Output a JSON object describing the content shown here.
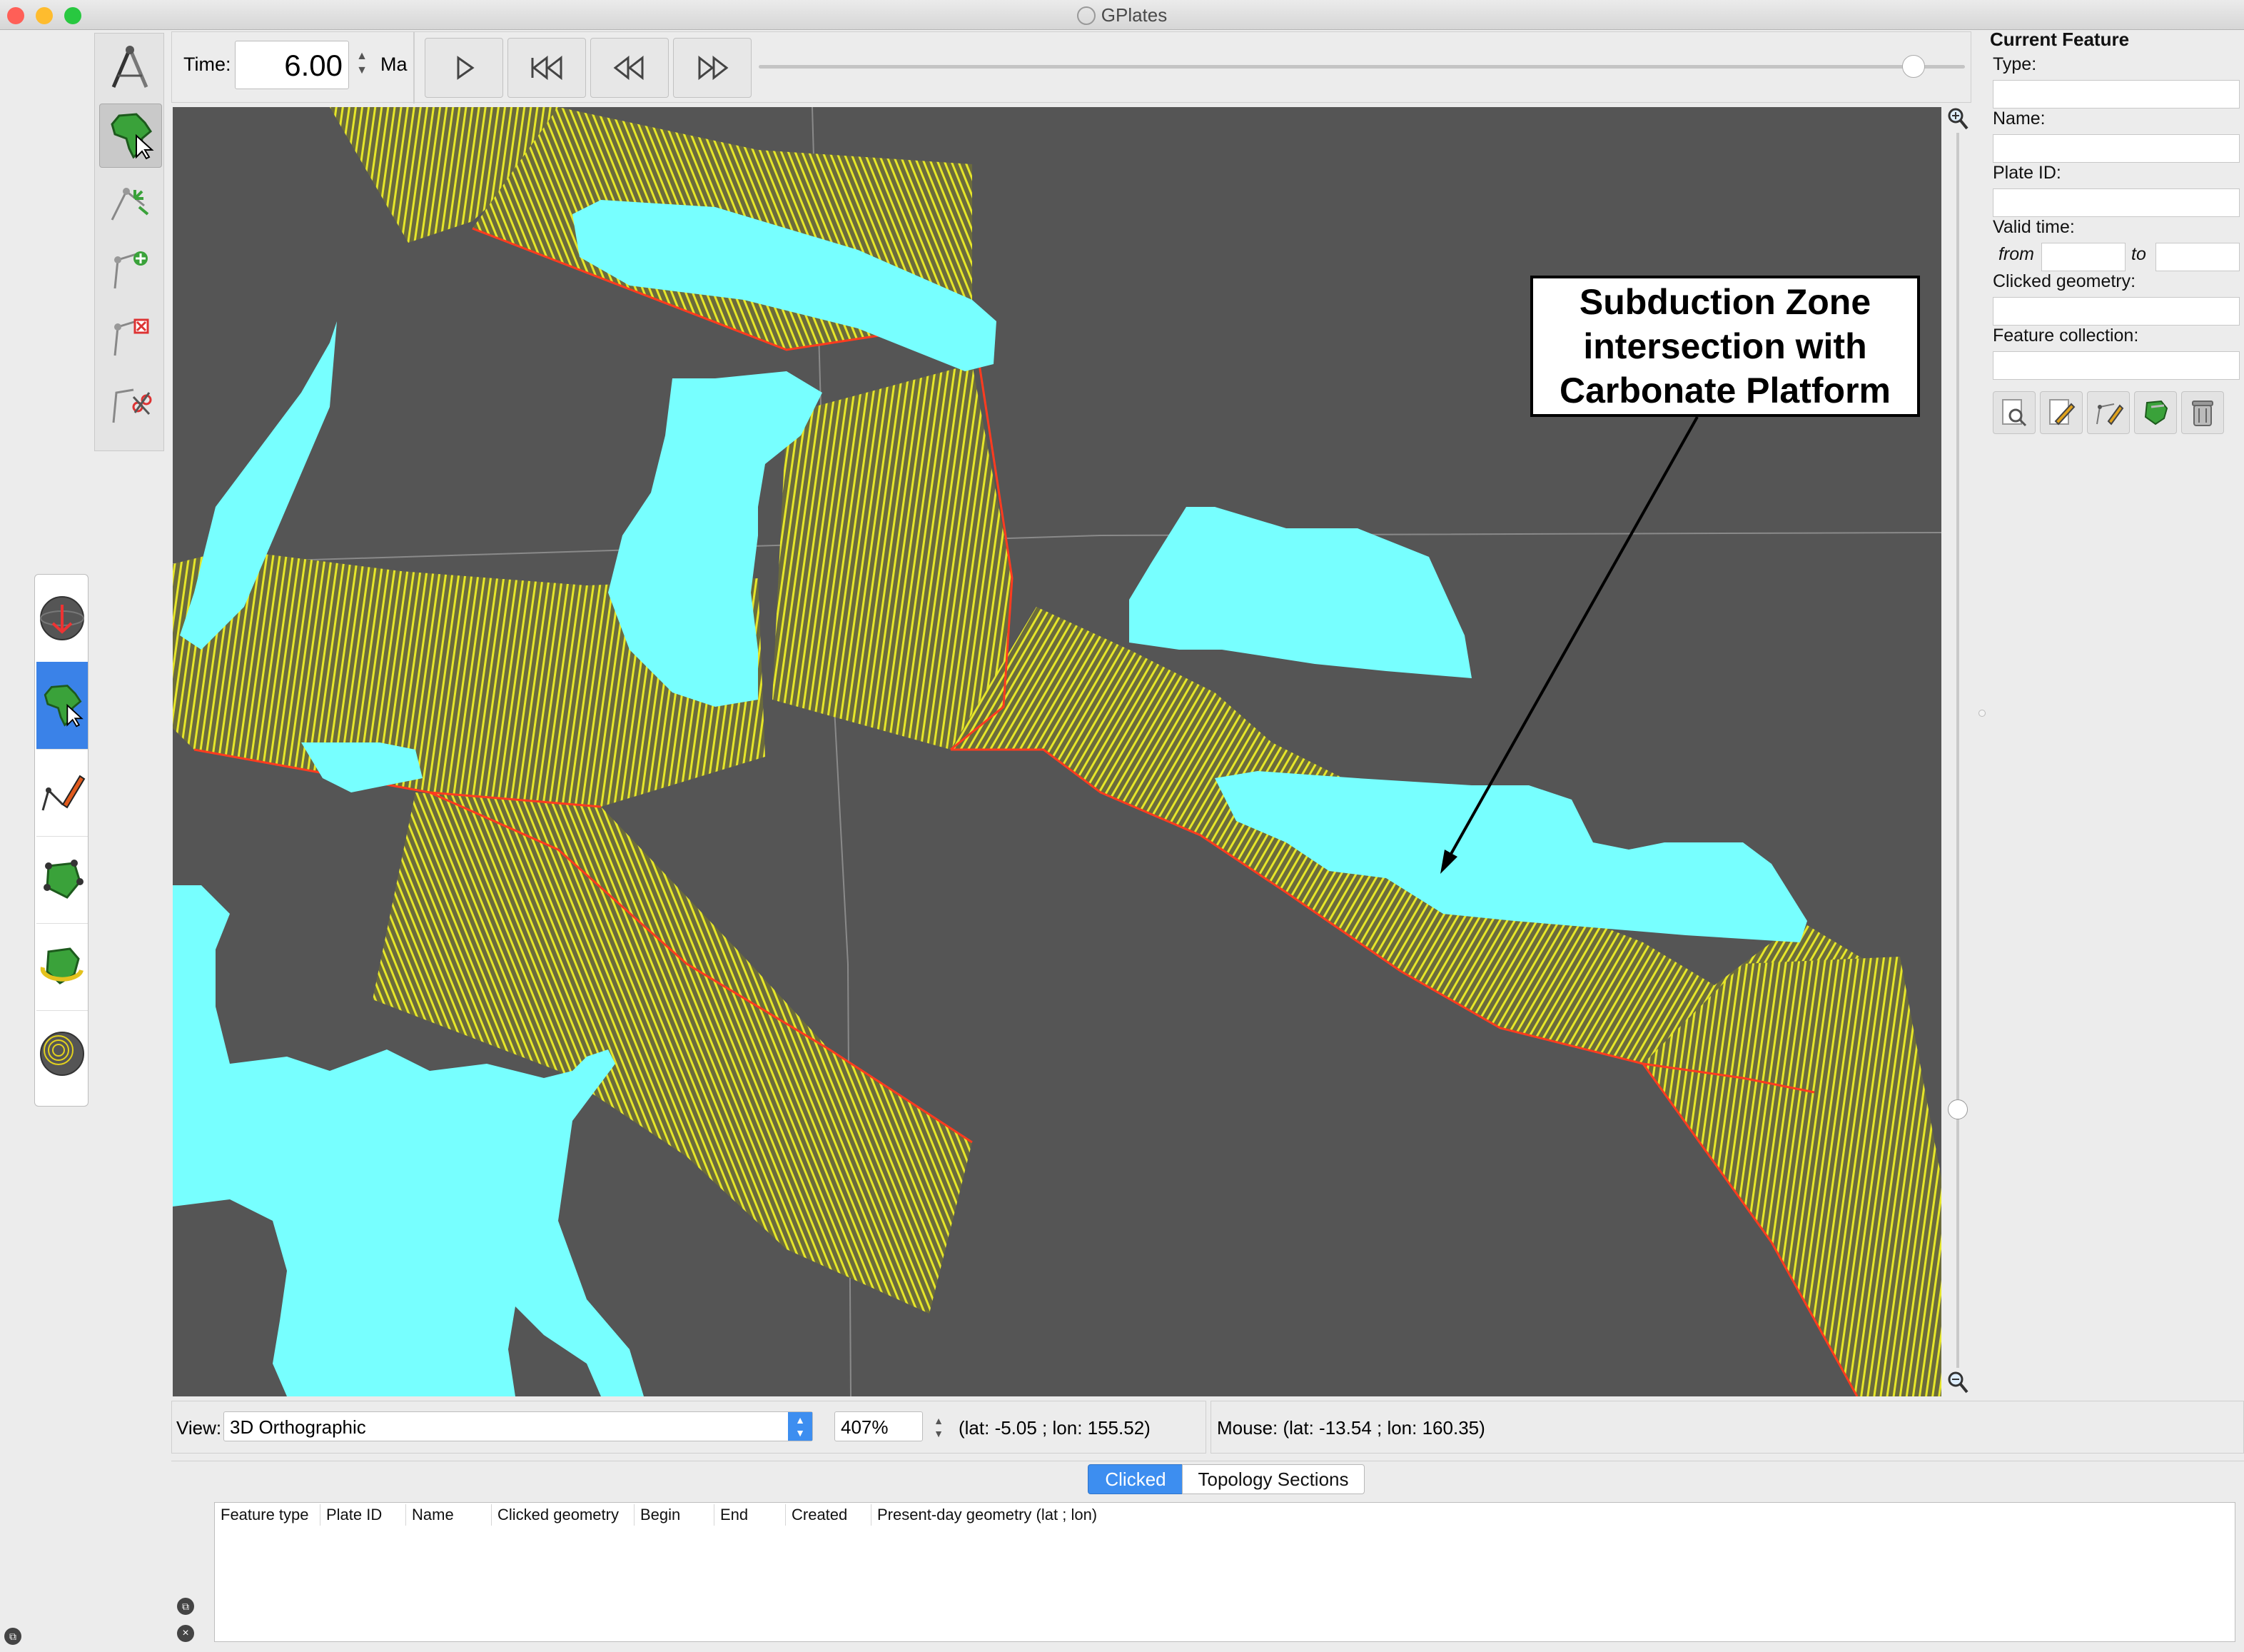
{
  "window": {
    "title": "GPlates"
  },
  "time_controls": {
    "label": "Time:",
    "value": "6.00",
    "unit": "Ma"
  },
  "annotation": {
    "lines": [
      "Subduction Zone",
      "intersection with",
      "Carbonate Platform"
    ]
  },
  "current_feature": {
    "heading": "Current Feature",
    "type_label": "Type:",
    "name_label": "Name:",
    "plate_id_label": "Plate ID:",
    "valid_time_label": "Valid time:",
    "from_label": "from",
    "to_label": "to",
    "clicked_geometry_label": "Clicked geometry:",
    "feature_collection_label": "Feature collection:"
  },
  "view_bar": {
    "label": "View:",
    "projection": "3D Orthographic",
    "zoom": "407%",
    "camera_coords": "(lat: -5.05 ; lon: 155.52)"
  },
  "mouse_bar": {
    "text": "Mouse: (lat: -13.54 ; lon: 160.35)"
  },
  "bottom_panel": {
    "tabs": [
      {
        "label": "Clicked",
        "active": true
      },
      {
        "label": "Topology Sections",
        "active": false
      }
    ],
    "columns": [
      "Feature type",
      "Plate ID",
      "Name",
      "Clicked geometry",
      "Begin",
      "End",
      "Created",
      "Present-day geometry (lat ; lon)"
    ]
  },
  "colors": {
    "globe_background": "#555555",
    "platform": "#77ffff",
    "hatch": "#e6e629",
    "subduction_line": "#ff3b1f",
    "active_tab": "#3d8ef0"
  }
}
